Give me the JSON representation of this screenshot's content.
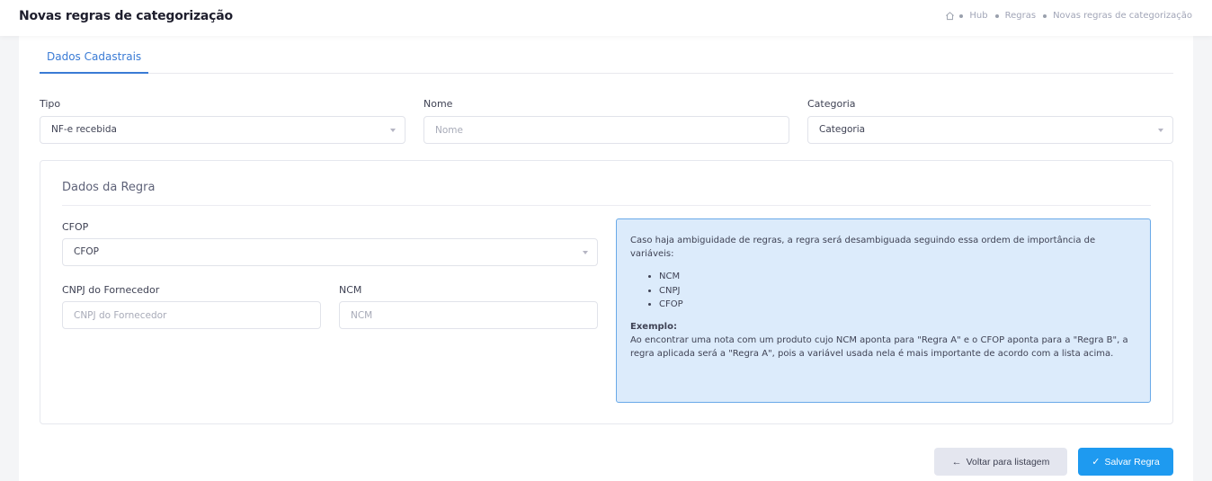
{
  "header": {
    "title": "Novas regras de categorização",
    "breadcrumb": [
      "Hub",
      "Regras",
      "Novas regras de categorização"
    ]
  },
  "tabs": [
    {
      "label": "Dados Cadastrais",
      "active": true
    }
  ],
  "form": {
    "tipo": {
      "label": "Tipo",
      "value": "NF-e recebida"
    },
    "nome": {
      "label": "Nome",
      "placeholder": "Nome"
    },
    "categoria": {
      "label": "Categoria",
      "value": "Categoria"
    }
  },
  "rule": {
    "title": "Dados da Regra",
    "cfop": {
      "label": "CFOP",
      "value": "CFOP"
    },
    "cnpj": {
      "label": "CNPJ do Fornecedor",
      "placeholder": "CNPJ do Fornecedor"
    },
    "ncm": {
      "label": "NCM",
      "placeholder": "NCM"
    },
    "info": {
      "intro": "Caso haja ambiguidade de regras, a regra será desambiguada seguindo essa ordem de importância de variáveis:",
      "items": [
        "NCM",
        "CNPJ",
        "CFOP"
      ],
      "example_title": "Exemplo:",
      "example_text": "Ao encontrar uma nota com um produto cujo NCM aponta para \"Regra A\" e o CFOP aponta para a \"Regra B\", a regra aplicada será a \"Regra A\", pois a variável usada nela é mais importante de acordo com a lista acima."
    }
  },
  "actions": {
    "back_label": "Voltar para listagem",
    "save_label": "Salvar Regra"
  },
  "icons": {
    "home": "home-icon",
    "back": "arrow-left-icon",
    "save": "check-icon"
  },
  "colors": {
    "accent": "#3a7bd5",
    "save_button": "#1e9af0",
    "info_bg": "#dcebfb",
    "info_border": "#69a9e8"
  }
}
